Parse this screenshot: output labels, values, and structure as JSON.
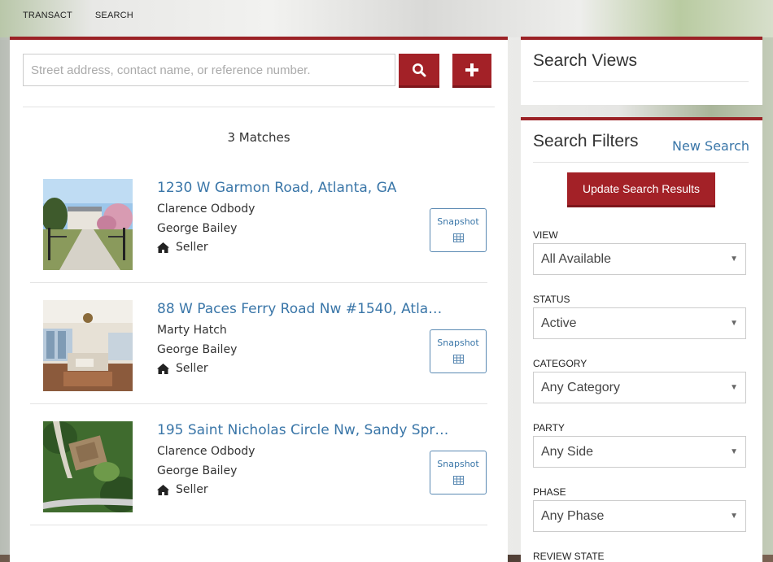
{
  "topnav": {
    "transact": "TRANSACT",
    "search": "SEARCH"
  },
  "search": {
    "placeholder": "Street address, contact name, or reference number.",
    "value": ""
  },
  "matches_label": "3 Matches",
  "results": [
    {
      "title": "1230 W Garmon Road, Atlanta, GA",
      "contact": "Clarence Odbody",
      "agent": "George Bailey",
      "side": "Seller",
      "snapshot_label": "Snapshot"
    },
    {
      "title": "88 W Paces Ferry Road Nw #1540, Atlanta,...",
      "contact": "Marty Hatch",
      "agent": "George Bailey",
      "side": "Seller",
      "snapshot_label": "Snapshot"
    },
    {
      "title": "195 Saint Nicholas Circle Nw, Sandy Spri...",
      "contact": "Clarence Odbody",
      "agent": "George Bailey",
      "side": "Seller",
      "snapshot_label": "Snapshot"
    }
  ],
  "search_views": {
    "title": "Search Views"
  },
  "filters": {
    "title": "Search Filters",
    "new_search": "New Search",
    "update_button": "Update Search Results",
    "fields": [
      {
        "label": "VIEW",
        "value": "All Available"
      },
      {
        "label": "STATUS",
        "value": "Active"
      },
      {
        "label": "CATEGORY",
        "value": "Any Category"
      },
      {
        "label": "PARTY",
        "value": "Any Side"
      },
      {
        "label": "PHASE",
        "value": "Any Phase"
      },
      {
        "label": "REVIEW STATE",
        "value": ""
      }
    ]
  },
  "colors": {
    "accent": "#a32127",
    "link": "#3a76a8"
  }
}
